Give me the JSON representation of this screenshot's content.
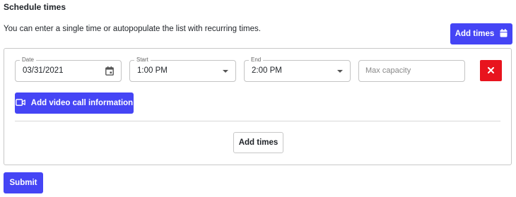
{
  "header": {
    "title": "Schedule times",
    "description": "You can enter a single time or autopopulate the list with recurring times.",
    "add_times_label": "Add times"
  },
  "row": {
    "date": {
      "label": "Date",
      "value": "03/31/2021"
    },
    "start": {
      "label": "Start",
      "value": "1:00 PM"
    },
    "end": {
      "label": "End",
      "value": "2:00 PM"
    },
    "capacity": {
      "placeholder": "Max capacity"
    }
  },
  "panel": {
    "video_call_label": "Add video call information",
    "add_times_label": "Add times"
  },
  "footer": {
    "submit_label": "Submit"
  },
  "colors": {
    "primary": "#4545f5",
    "danger": "#e8141e"
  }
}
